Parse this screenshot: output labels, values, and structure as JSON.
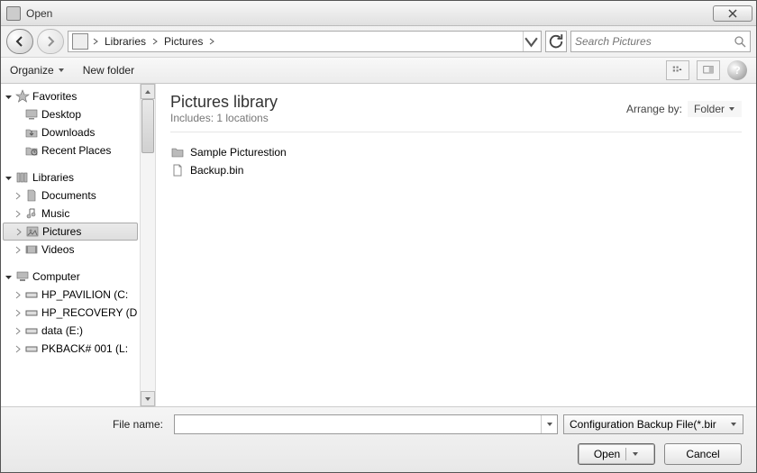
{
  "window": {
    "title": "Open"
  },
  "breadcrumb": {
    "items": [
      "Libraries",
      "Pictures"
    ]
  },
  "search": {
    "placeholder": "Search Pictures"
  },
  "toolbar": {
    "organize": "Organize",
    "newfolder": "New folder"
  },
  "nav": {
    "favorites": {
      "label": "Favorites",
      "items": [
        "Desktop",
        "Downloads",
        "Recent Places"
      ]
    },
    "libraries": {
      "label": "Libraries",
      "items": [
        "Documents",
        "Music",
        "Pictures",
        "Videos"
      ],
      "selected": "Pictures"
    },
    "computer": {
      "label": "Computer",
      "items": [
        "HP_PAVILION (C:",
        "HP_RECOVERY (D",
        "data (E:)",
        "PKBACK# 001 (L:"
      ]
    }
  },
  "library": {
    "title": "Pictures library",
    "subtitle": "Includes:  1 locations",
    "arrange_label": "Arrange by:",
    "arrange_value": "Folder"
  },
  "files": [
    {
      "name": "Sample Picturestion",
      "type": "folder"
    },
    {
      "name": "Backup.bin",
      "type": "file"
    }
  ],
  "bottom": {
    "filename_label": "File name:",
    "filename_value": "",
    "filter": "Configuration Backup File(*.bir",
    "open": "Open",
    "cancel": "Cancel"
  }
}
